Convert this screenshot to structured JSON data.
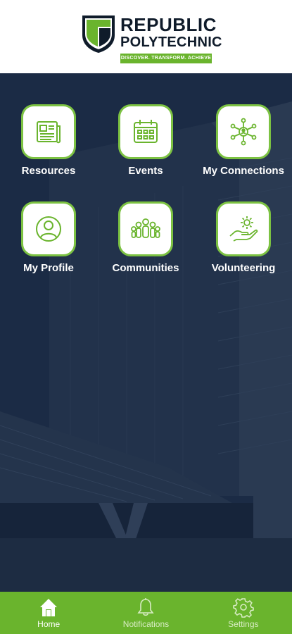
{
  "brand": {
    "line1": "REPUBLIC",
    "line2": "POLYTECHNIC",
    "tagline": "DISCOVER. TRANSFORM. ACHIEVE"
  },
  "tiles": [
    {
      "label": "Resources",
      "icon": "newspaper-icon"
    },
    {
      "label": "Events",
      "icon": "calendar-icon"
    },
    {
      "label": "My Connections",
      "icon": "network-icon"
    },
    {
      "label": "My Profile",
      "icon": "user-icon"
    },
    {
      "label": "Communities",
      "icon": "group-icon"
    },
    {
      "label": "Volunteering",
      "icon": "hand-gear-icon"
    }
  ],
  "nav": [
    {
      "label": "Home",
      "icon": "home-icon",
      "active": true
    },
    {
      "label": "Notifications",
      "icon": "bell-icon",
      "active": false
    },
    {
      "label": "Settings",
      "icon": "gear-icon",
      "active": false
    }
  ],
  "colors": {
    "accent": "#6ab42d",
    "icon_border": "#7cc242",
    "background": "#1b2b45"
  }
}
